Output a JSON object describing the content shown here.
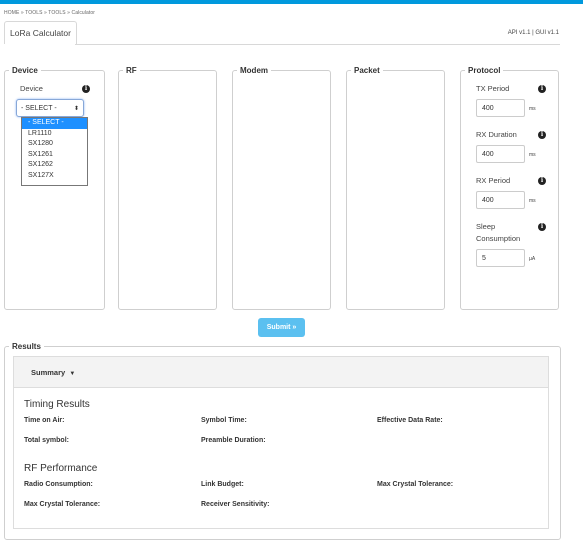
{
  "breadcrumb": "HOME » TOOLS » TOOLS » Calculator",
  "tab": {
    "label": "LoRa Calculator"
  },
  "version": "API v1.1 | GUI v1.1",
  "fieldsets": {
    "device": "Device",
    "rf": "RF",
    "modem": "Modem",
    "packet": "Packet",
    "protocol": "Protocol"
  },
  "device": {
    "label": "Device",
    "selected": "- SELECT -",
    "options": [
      "- SELECT -",
      "LR1110",
      "SX1280",
      "SX1261",
      "SX1262",
      "SX127X"
    ]
  },
  "protocol": {
    "tx_period": {
      "label": "TX Period",
      "value": "400",
      "unit": "ms"
    },
    "rx_duration": {
      "label": "RX Duration",
      "value": "400",
      "unit": "ms"
    },
    "rx_period": {
      "label": "RX Period",
      "value": "400",
      "unit": "ms"
    },
    "sleep": {
      "label1": "Sleep",
      "label2": "Consumption",
      "value": "5",
      "unit": "µA"
    }
  },
  "submit_label": "Submit »",
  "results": {
    "legend": "Results",
    "summary": "Summary",
    "timing_title": "Timing Results",
    "time_on_air": "Time on Air:",
    "symbol_time": "Symbol Time:",
    "effective_data_rate": "Effective Data Rate:",
    "total_symbol": "Total symbol:",
    "preamble_duration": "Preamble Duration:",
    "rf_title": "RF Performance",
    "radio_consumption": "Radio Consumption:",
    "link_budget": "Link Budget:",
    "max_crystal_tolerance": "Max Crystal Tolerance:",
    "max_crystal_tolerance_2": "Max Crystal Tolerance:",
    "receiver_sensitivity": "Receiver Sensitivity:"
  },
  "icons": {
    "info": "info-icon",
    "caret": "caret-down-icon",
    "select_arrows": "updown-icon"
  }
}
